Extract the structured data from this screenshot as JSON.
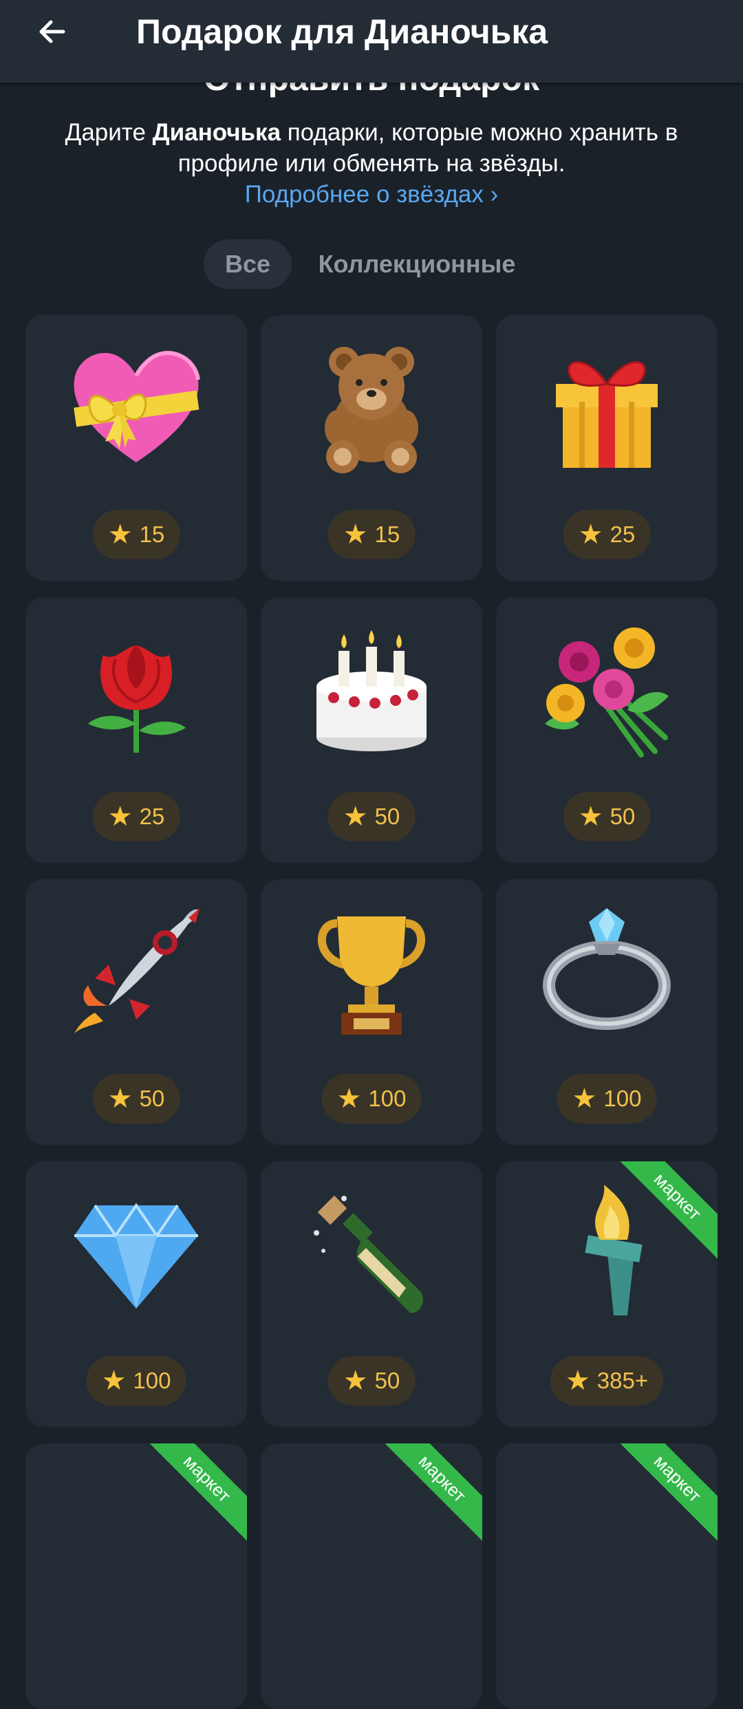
{
  "header": {
    "title": "Подарок для Дианочька"
  },
  "intro": {
    "heading": "Отправить подарок",
    "desc_prefix": "Дарите ",
    "desc_name": "Дианочька",
    "desc_suffix": " подарки, которые можно хранить в профиле или обменять на звёзды.",
    "link": "Подробнее о звёздах ›"
  },
  "tabs": [
    {
      "label": "Все",
      "active": true
    },
    {
      "label": "Коллекционные",
      "active": false
    }
  ],
  "gifts": [
    {
      "name": "heart-with-bow",
      "price": "15"
    },
    {
      "name": "teddy-bear",
      "price": "15"
    },
    {
      "name": "gift-box",
      "price": "25"
    },
    {
      "name": "rose",
      "price": "25"
    },
    {
      "name": "birthday-cake",
      "price": "50"
    },
    {
      "name": "flower-bouquet",
      "price": "50"
    },
    {
      "name": "rocket",
      "price": "50"
    },
    {
      "name": "trophy",
      "price": "100"
    },
    {
      "name": "diamond-ring",
      "price": "100"
    },
    {
      "name": "diamond",
      "price": "100"
    },
    {
      "name": "champagne",
      "price": "50"
    },
    {
      "name": "torch",
      "price": "385+",
      "badge": "маркет"
    }
  ],
  "partial_row_badges": [
    "маркет",
    "маркет",
    "маркет"
  ],
  "colors": {
    "background": "#1a2129",
    "header": "#242c36",
    "card": "#232b35",
    "link": "#5aa7f0",
    "price_text": "#f2c14e",
    "badge": "#34b84a"
  }
}
